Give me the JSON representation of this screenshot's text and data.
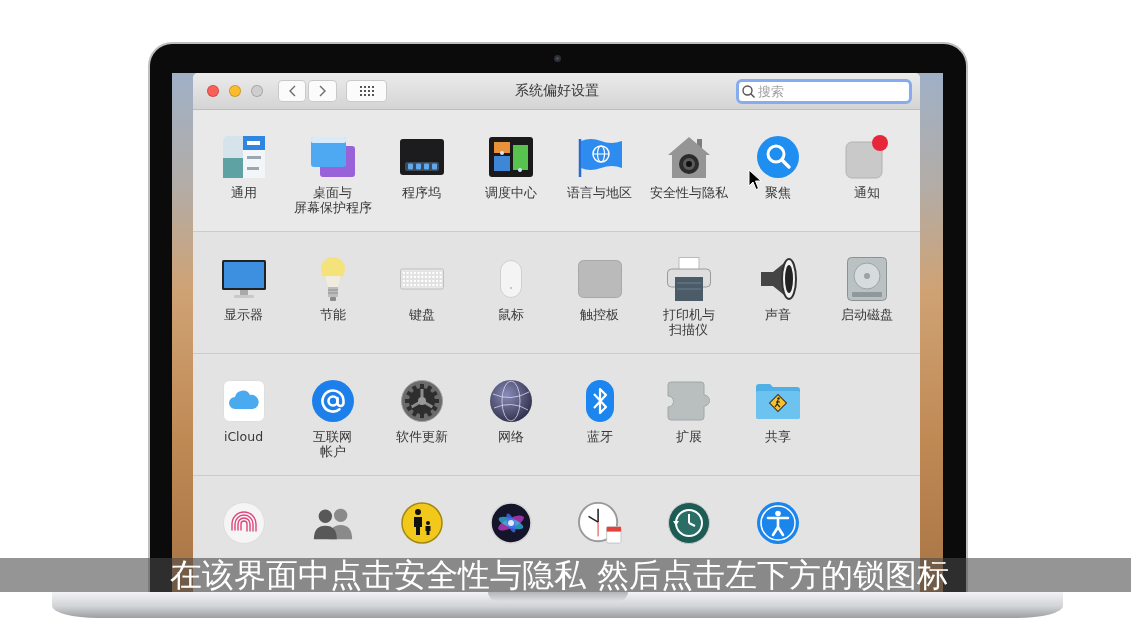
{
  "window": {
    "title": "系统偏好设置",
    "zoom_disabled": true,
    "search": {
      "placeholder": "搜索",
      "focused": true
    }
  },
  "sections": [
    {
      "panes": [
        {
          "lines": [
            "通用"
          ]
        },
        {
          "lines": [
            "桌面与",
            "屏幕保护程序"
          ]
        },
        {
          "lines": [
            "程序坞"
          ]
        },
        {
          "lines": [
            "调度中心"
          ]
        },
        {
          "lines": [
            "语言与地区"
          ]
        },
        {
          "lines": [
            "安全性与隐私"
          ]
        },
        {
          "lines": [
            "聚焦"
          ]
        },
        {
          "lines": [
            "通知"
          ]
        }
      ]
    },
    {
      "panes": [
        {
          "lines": [
            "显示器"
          ]
        },
        {
          "lines": [
            "节能"
          ]
        },
        {
          "lines": [
            "键盘"
          ]
        },
        {
          "lines": [
            "鼠标"
          ]
        },
        {
          "lines": [
            "触控板"
          ]
        },
        {
          "lines": [
            "打印机与",
            "扫描仪"
          ]
        },
        {
          "lines": [
            "声音"
          ]
        },
        {
          "lines": [
            "启动磁盘"
          ]
        }
      ]
    },
    {
      "panes": [
        {
          "lines": [
            "iCloud"
          ]
        },
        {
          "lines": [
            "互联网",
            "帐户"
          ]
        },
        {
          "lines": [
            "软件更新"
          ]
        },
        {
          "lines": [
            "网络"
          ]
        },
        {
          "lines": [
            "蓝牙"
          ]
        },
        {
          "lines": [
            "扩展"
          ]
        },
        {
          "lines": [
            "共享"
          ]
        }
      ]
    }
  ],
  "caption": "在该界面中点击安全性与隐私 然后点击左下方的锁图标"
}
